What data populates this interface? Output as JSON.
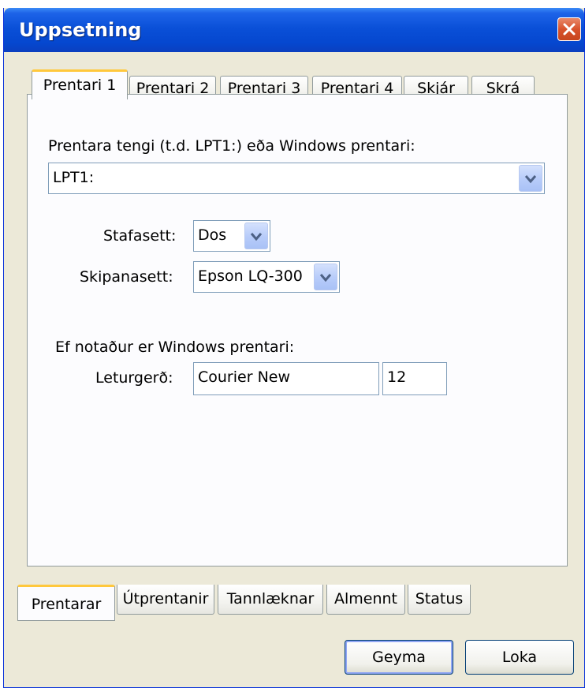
{
  "window": {
    "title": "Uppsetning"
  },
  "top_tabs": [
    {
      "label": "Prentari 1",
      "active": true
    },
    {
      "label": "Prentari 2"
    },
    {
      "label": "Prentari 3"
    },
    {
      "label": "Prentari 4"
    },
    {
      "label": "Skjár"
    },
    {
      "label": "Skrá"
    }
  ],
  "printer": {
    "port_label": "Prentara tengi (t.d. LPT1:) eða Windows prentari:",
    "port_value": "LPT1:",
    "charset_label": "Stafasett:",
    "charset_value": "Dos",
    "commandset_label": "Skipanasett:",
    "commandset_value": "Epson LQ-300",
    "windows_note": "Ef notaður er Windows prentari:",
    "font_label": "Leturgerð:",
    "font_value": "Courier New",
    "font_size": "12"
  },
  "bottom_tabs": [
    {
      "label": "Prentarar",
      "active": true
    },
    {
      "label": "Útprentanir"
    },
    {
      "label": "Tannlæknar"
    },
    {
      "label": "Almennt"
    },
    {
      "label": "Status"
    }
  ],
  "buttons": {
    "save": "Geyma",
    "close": "Loka"
  },
  "colors": {
    "title_bar": "#0a50d8",
    "active_tab_accent": "#ffc83c",
    "dialog_bg": "#ece9d8"
  }
}
